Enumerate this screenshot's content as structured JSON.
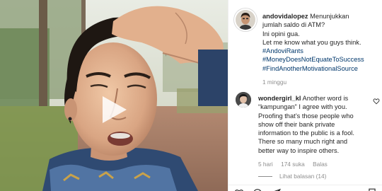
{
  "video": {
    "play_icon": "play-icon"
  },
  "post": {
    "username": "andovidalopez",
    "caption_lines": [
      "Menunjukkan",
      "jumlah saldo di ATM?",
      "Ini opini gua.",
      "Let me know what you guys think."
    ],
    "hashtags": [
      "#AndoviRants",
      "#MoneyDoesNotEquateToSuccess",
      "#FindAnotherMotivationalSource"
    ],
    "time_ago": "1 minggu"
  },
  "comment": {
    "username": "wondergirl_kl",
    "text": "Another word is “kampungan” I agree with you. Proofing that’s those people who show off their bank private information to the public is a fool. There so many much right and better way to inspire others.",
    "time_ago": "5 hari",
    "likes": "174 suka",
    "reply_label": "Balas",
    "view_replies": "Lihat balasan (14)"
  },
  "colors": {
    "link": "#00376b",
    "secondary_text": "#8e8e8e",
    "primary_text": "#262626"
  },
  "icons": [
    "play-icon",
    "heart-icon",
    "comment-icon",
    "share-icon",
    "bookmark-icon"
  ]
}
